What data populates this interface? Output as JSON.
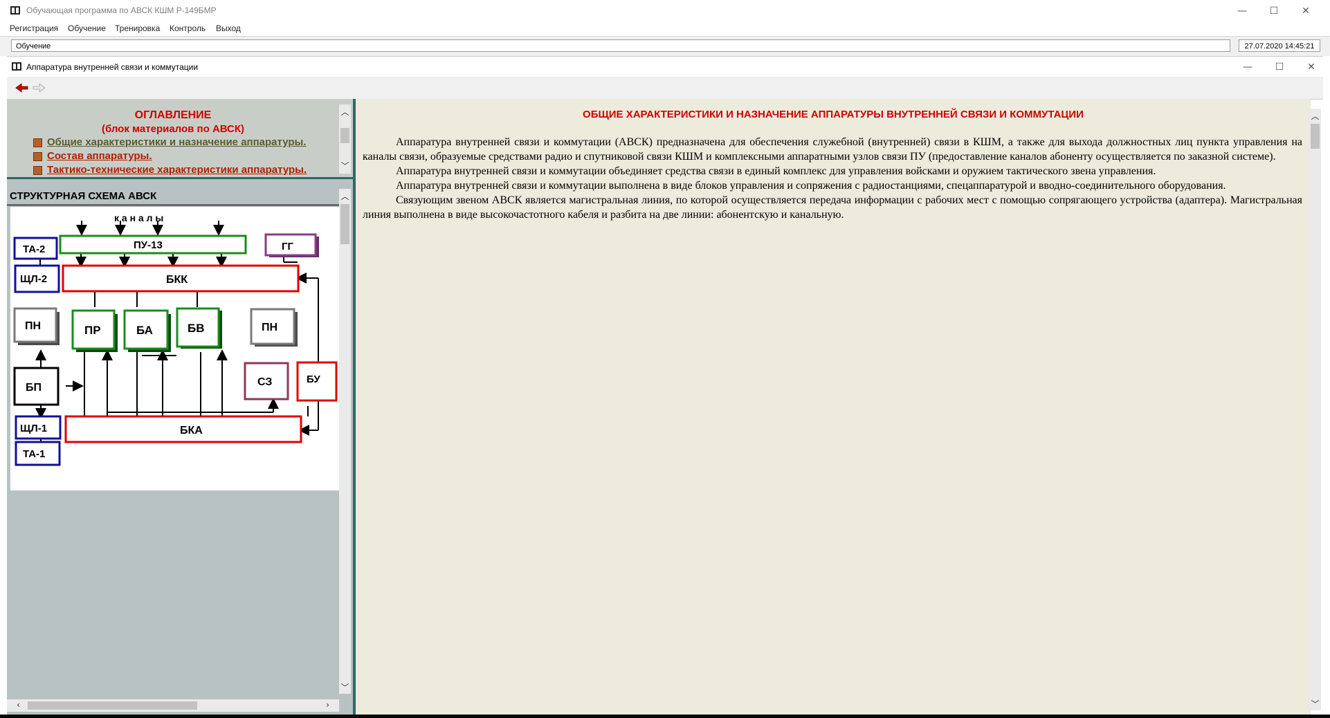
{
  "outer_window": {
    "title": "Обучающая программа по АВСК КШМ Р-149БМР",
    "menu": [
      "Регистрация",
      "Обучение",
      "Тренировка",
      "Контроль",
      "Выход"
    ],
    "status_left": "Обучение",
    "status_right": "27.07.2020 14:45:21"
  },
  "inner_window": {
    "title": "Аппаратура внутренней связи и коммутации"
  },
  "window_buttons": {
    "minimize": "—",
    "maximize": "☐",
    "close": "✕"
  },
  "toolbar": {
    "back_icon": "back-arrow-icon",
    "forward_icon": "forward-arrow-icon"
  },
  "toc": {
    "heading": "ОГЛАВЛЕНИЕ",
    "subheading": "(блок материалов по АВСК)",
    "items": [
      {
        "label": "Общие характеристики и назначение аппаратуры.",
        "color": "#5a5a30"
      },
      {
        "label": "Состав аппаратуры.",
        "color": "#b02000"
      },
      {
        "label": "Тактико-технические характеристики аппаратуры.",
        "color": "#b02000"
      }
    ]
  },
  "scheme": {
    "title": "СТРУКТУРНАЯ СХЕМА АВСК",
    "channels_label": "к а н а л ы",
    "blocks": {
      "pu13": "ПУ-13",
      "bkk": "БКК",
      "bka": "БКА",
      "ta2": "ТА-2",
      "shchl2": "ЩЛ-2",
      "gg": "ГГ",
      "pn_left": "ПН",
      "pr": "ПР",
      "ba": "БА",
      "bv": "БВ",
      "pn_right": "ПН",
      "bp": "БП",
      "sz": "СЗ",
      "bu": "БУ",
      "shchl1": "ЩЛ-1",
      "ta1": "ТА-1"
    }
  },
  "content": {
    "heading": "ОБЩИЕ ХАРАКТЕРИСТИКИ И НАЗНАЧЕНИЕ АППАРАТУРЫ ВНУТРЕННЕЙ СВЯЗИ И КОММУТАЦИИ",
    "paragraphs": [
      "Аппаратура внутренней связи и коммутации (АВСК) предназначена для обеспечения служебной (внутренней) связи в КШМ, а также для выхода должностных лиц пункта управления на каналы связи, образуемые средствами радио и спутниковой связи КШМ и комплексными аппаратными узлов связи ПУ (предоставление каналов абоненту осуществляется по заказной системе).",
      "Аппаратура внутренней связи и коммутации объединяет средства связи в единый комплекс для управления войсками и оружием тактического звена управления.",
      "Аппаратура внутренней связи и коммутации выполнена в виде блоков управления и сопряжения с радиостанциями, спецаппаратурой и вводно-соединительного оборудования.",
      "Связующим звеном АВСК является магистральная линия, по которой осуществляется передача информации с рабочих мест с помощью сопрягающего устройства (адаптера). Магистральная линия выполнена в виде высокочастотного кабеля и разбита на две линии: абонентскую и канальную."
    ]
  },
  "colors": {
    "heading_red": "#d00000",
    "frame_teal": "#2a6b6b",
    "content_bg": "#ecebdc",
    "toc_bg": "#c8cec7"
  }
}
